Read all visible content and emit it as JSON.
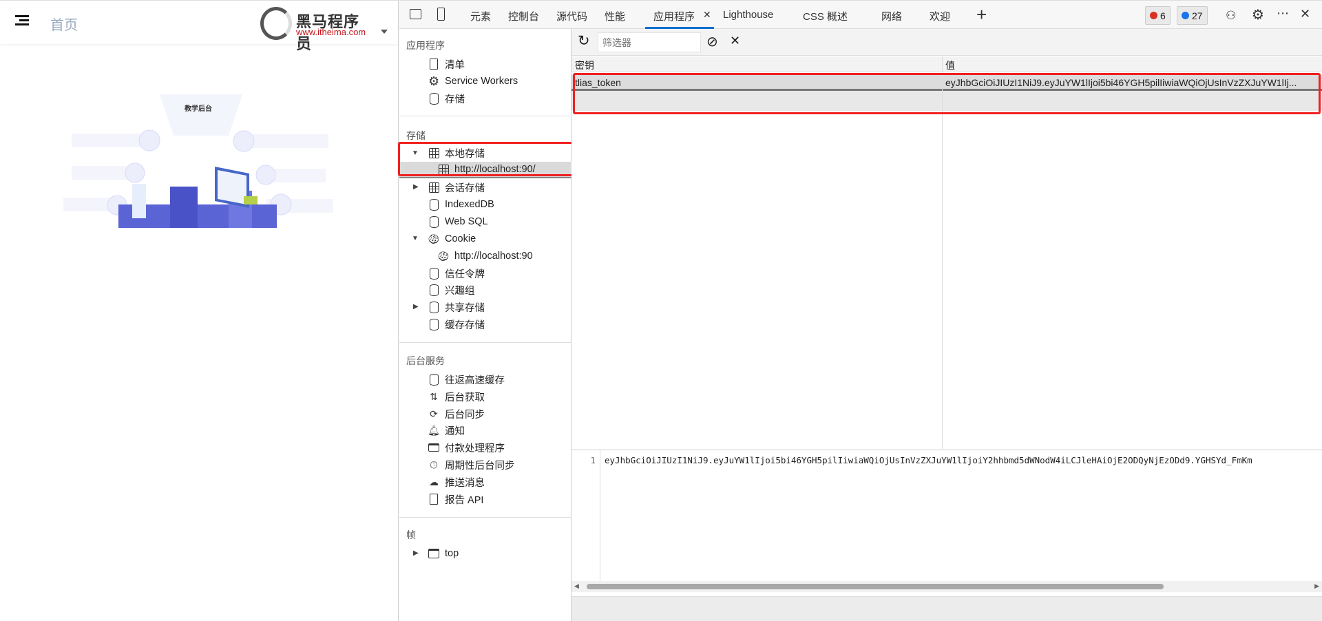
{
  "page": {
    "home_label": "首页",
    "logo_title": "黑马程序员",
    "logo_url": "www.itheima.com",
    "illustration_title": "教学后台"
  },
  "devtools": {
    "tabs": [
      "元素",
      "控制台",
      "源代码",
      "性能",
      "应用程序",
      "Lighthouse",
      "CSS 概述",
      "网络",
      "欢迎"
    ],
    "active_tab": "应用程序",
    "errors": "6",
    "messages": "27",
    "colors": {
      "accent": "#0b6fd1",
      "error": "#d93025",
      "info": "#1a73e8",
      "highlight": "#f02020"
    },
    "sidebar": {
      "app_heading": "应用程序",
      "app_items": [
        "清单",
        "Service Workers",
        "存储"
      ],
      "storage_heading": "存储",
      "storage_items": [
        "本地存储",
        "http://localhost:90/",
        "会话存储",
        "IndexedDB",
        "Web SQL",
        "Cookie",
        "http://localhost:90",
        "信任令牌",
        "兴趣组",
        "共享存储",
        "缓存存储"
      ],
      "bg_heading": "后台服务",
      "bg_items": [
        "往返高速缓存",
        "后台获取",
        "后台同步",
        "通知",
        "付款处理程序",
        "周期性后台同步",
        "推送消息",
        "报告 API"
      ],
      "frames_heading": "帧",
      "frames_items": [
        "top"
      ]
    },
    "filter_placeholder": "筛选器",
    "table": {
      "headers": [
        "密钥",
        "值"
      ],
      "rows": [
        {
          "key": "tlias_token",
          "value": "eyJhbGciOiJIUzI1NiJ9.eyJuYW1lIjoi5bi46YGH5pilIiwiaWQiOjUsInVzZXJuYW1lIj..."
        }
      ]
    },
    "editor": {
      "line": "1",
      "value": "eyJhbGciOiJIUzI1NiJ9.eyJuYW1lIjoi5bi46YGH5pilIiwiaWQiOjUsInVzZXJuYW1lIjoiY2hhbmd5dWNodW4iLCJleHAiOjE2ODQyNjEzODd9.YGHSYd_FmKm"
    }
  }
}
